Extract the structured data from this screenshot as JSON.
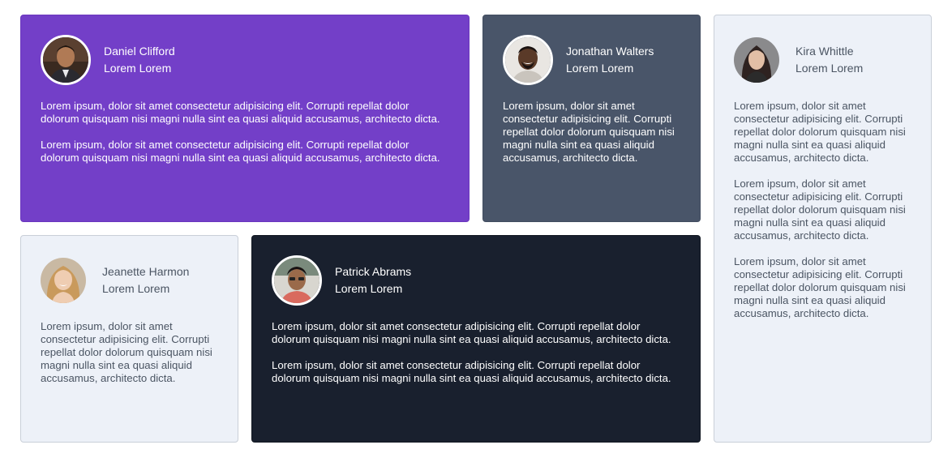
{
  "testimonials": [
    {
      "name": "Daniel Clifford",
      "role": "Lorem Lorem",
      "paragraphs": [
        "Lorem ipsum, dolor sit amet consectetur adipisicing elit. Corrupti repellat dolor dolorum quisquam nisi magni nulla sint ea quasi aliquid accusamus, architecto dicta.",
        "Lorem ipsum, dolor sit amet consectetur adipisicing elit. Corrupti repellat dolor dolorum quisquam nisi magni nulla sint ea quasi aliquid accusamus, architecto dicta."
      ],
      "theme_color": "#733fc8"
    },
    {
      "name": "Jonathan Walters",
      "role": "Lorem Lorem",
      "paragraphs": [
        "Lorem ipsum, dolor sit amet consectetur adipisicing elit. Corrupti repellat dolor dolorum quisquam nisi magni nulla sint ea quasi aliquid accusamus, architecto dicta."
      ],
      "theme_color": "#495569"
    },
    {
      "name": "Kira Whittle",
      "role": "Lorem Lorem",
      "paragraphs": [
        "Lorem ipsum, dolor sit amet consectetur adipisicing elit. Corrupti repellat dolor dolorum quisquam nisi magni nulla sint ea quasi aliquid accusamus, architecto dicta.",
        "Lorem ipsum, dolor sit amet consectetur adipisicing elit. Corrupti repellat dolor dolorum quisquam nisi magni nulla sint ea quasi aliquid accusamus, architecto dicta.",
        "Lorem ipsum, dolor sit amet consectetur adipisicing elit. Corrupti repellat dolor dolorum quisquam nisi magni nulla sint ea quasi aliquid accusamus, architecto dicta."
      ],
      "theme_color": "#edf1f8"
    },
    {
      "name": "Jeanette Harmon",
      "role": "Lorem Lorem",
      "paragraphs": [
        "Lorem ipsum, dolor sit amet consectetur adipisicing elit. Corrupti repellat dolor dolorum quisquam nisi magni nulla sint ea quasi aliquid accusamus, architecto dicta."
      ],
      "theme_color": "#edf1f8"
    },
    {
      "name": "Patrick Abrams",
      "role": "Lorem Lorem",
      "paragraphs": [
        "Lorem ipsum, dolor sit amet consectetur adipisicing elit. Corrupti repellat dolor dolorum quisquam nisi magni nulla sint ea quasi aliquid accusamus, architecto dicta.",
        "Lorem ipsum, dolor sit amet consectetur adipisicing elit. Corrupti repellat dolor dolorum quisquam nisi magni nulla sint ea quasi aliquid accusamus, architecto dicta."
      ],
      "theme_color": "#19202e"
    }
  ]
}
